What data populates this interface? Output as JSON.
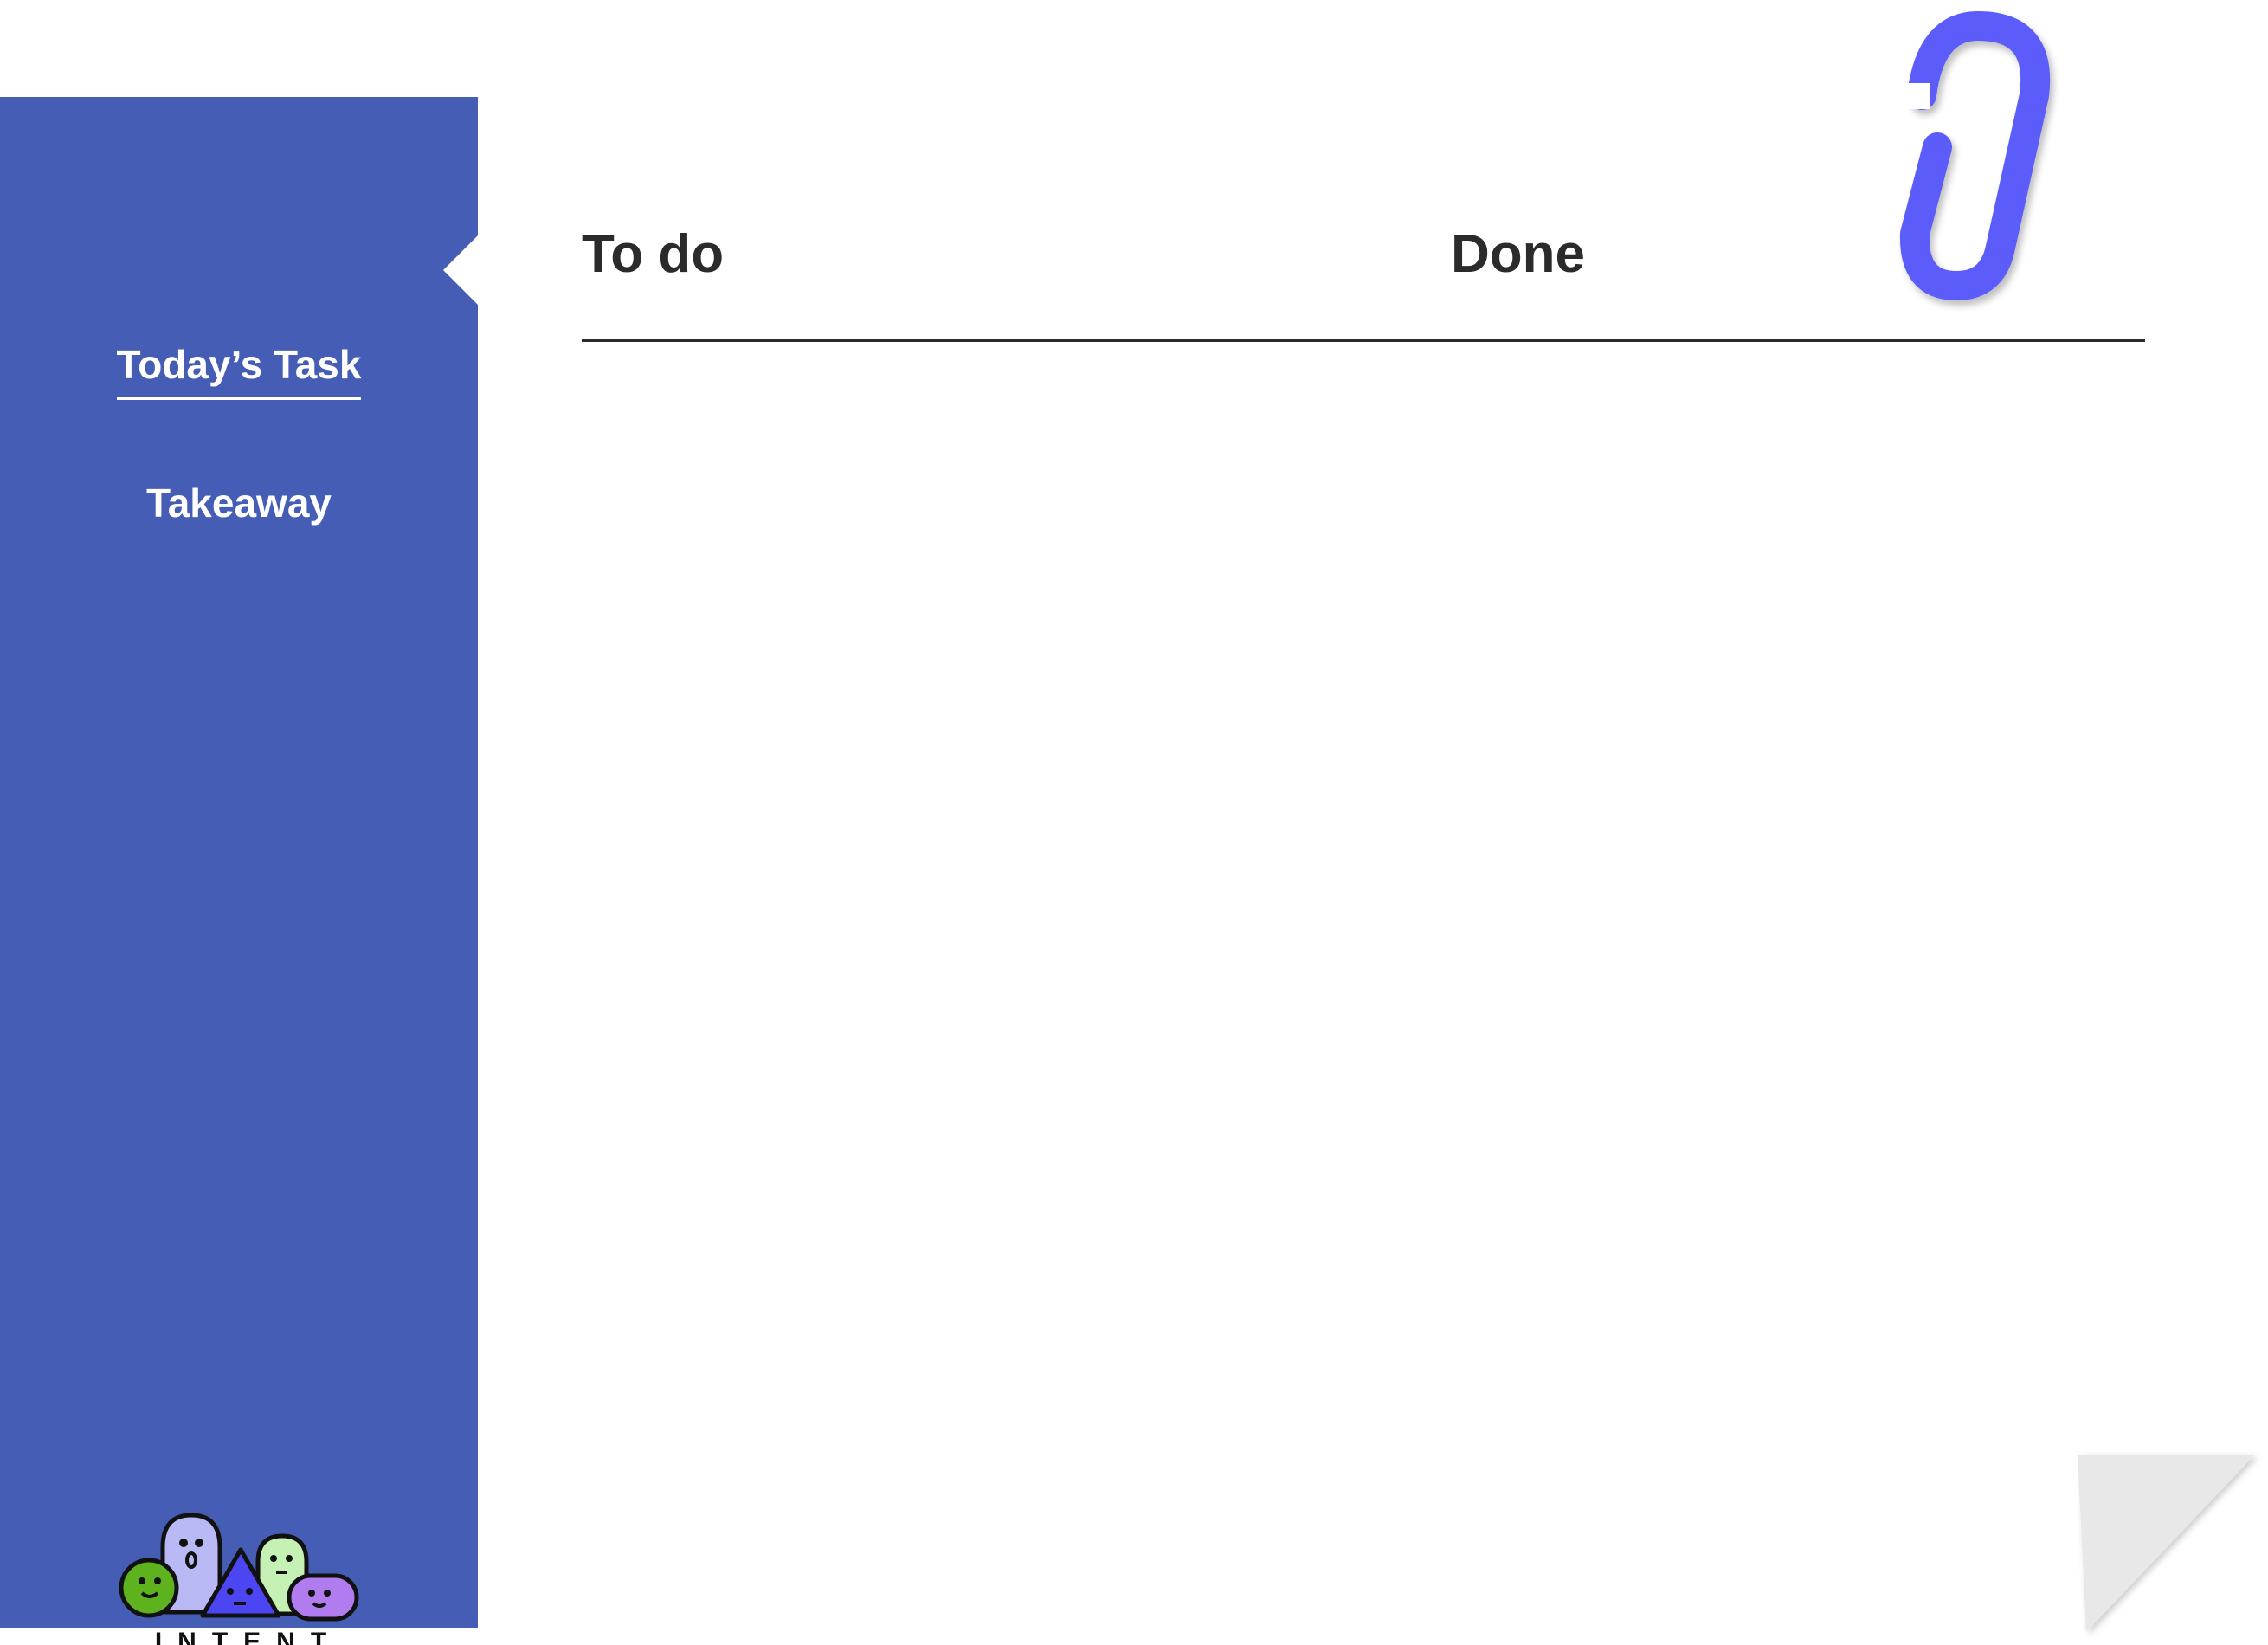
{
  "sidebar": {
    "items": [
      {
        "label": "Today’s Task",
        "active": true
      },
      {
        "label": "Takeaway",
        "active": false
      }
    ],
    "logo_text": "INTENT"
  },
  "board": {
    "columns": [
      {
        "label": "To do"
      },
      {
        "label": "Done"
      }
    ]
  },
  "colors": {
    "sidebar_bg": "#455db5",
    "clip": "#5b5bfa",
    "heading_text": "#2b2b2b",
    "page_curl": "#e8e8e8"
  },
  "icons": {
    "clip": "paperclip-icon",
    "corner": "page-curl-icon",
    "logo": "intent-characters-logo"
  }
}
